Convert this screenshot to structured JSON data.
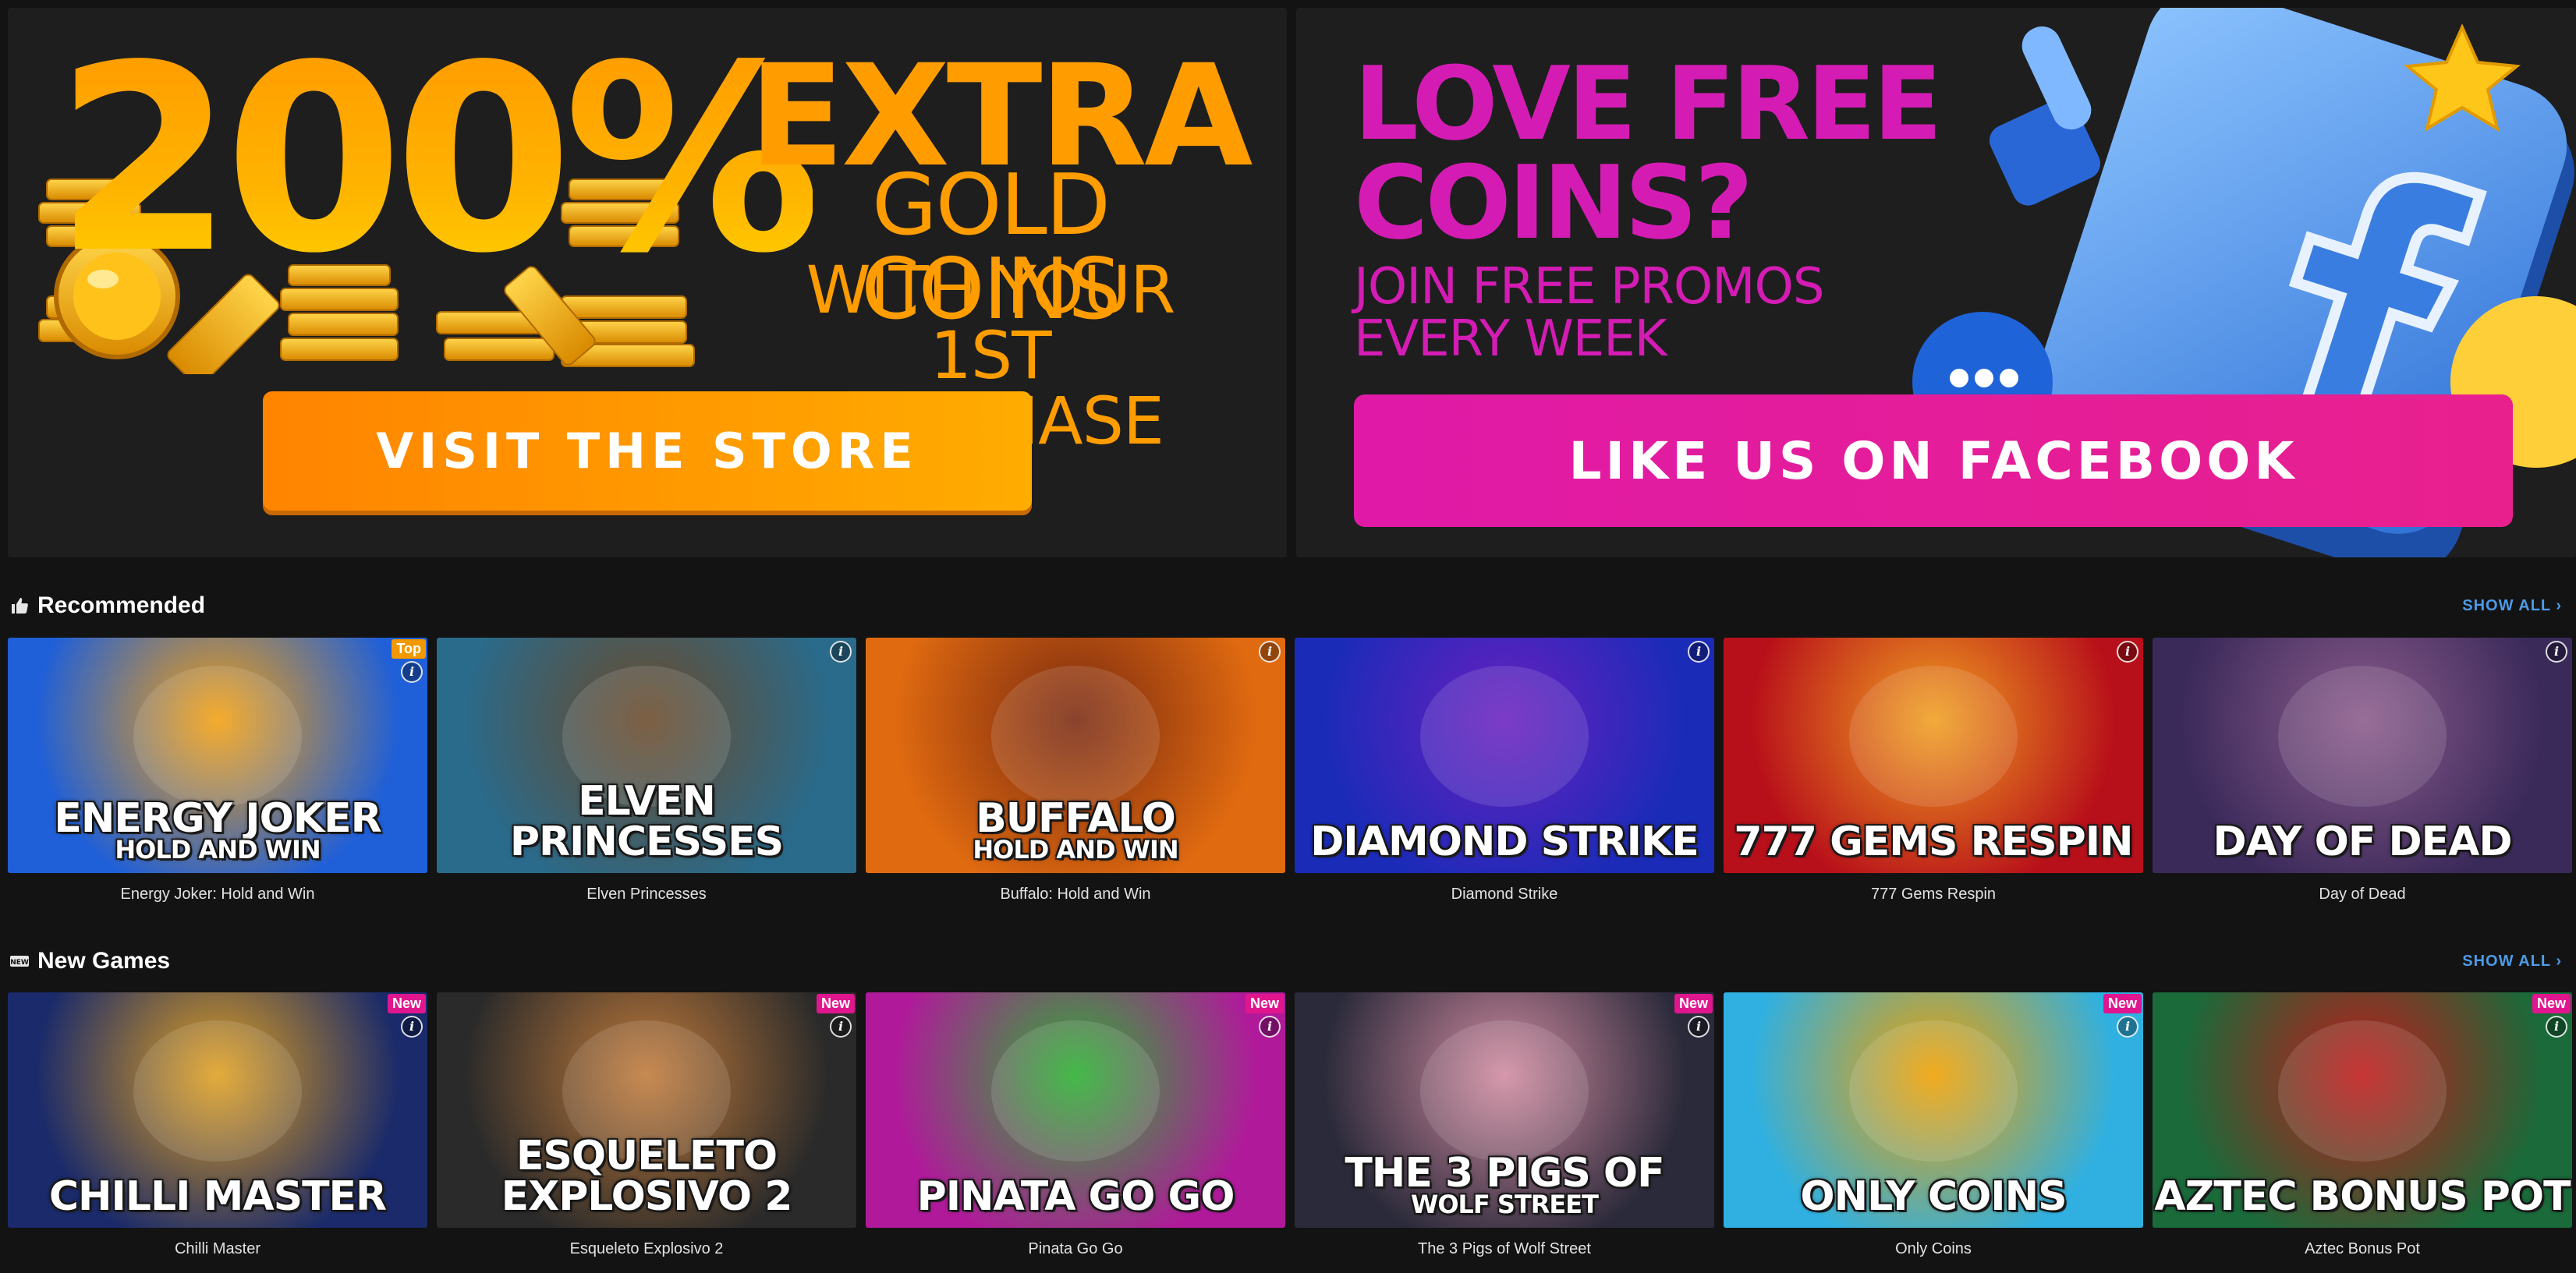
{
  "promo_store": {
    "percent": "200%",
    "extra": "EXTRA",
    "gold_coins": "GOLD COINS",
    "with_your": "WITH YOUR",
    "first_purchase": "1ST PURCHASE",
    "button": "VISIT THE STORE"
  },
  "promo_facebook": {
    "title_line1": "LOVE FREE",
    "title_line2": "COINS?",
    "sub_line1": "JOIN FREE PROMOS",
    "sub_line2": "EVERY WEEK",
    "button": "LIKE US ON FACEBOOK"
  },
  "sections": {
    "recommended": {
      "title": "Recommended",
      "show_all": "SHOW ALL ›",
      "icon": "thumbs-up-icon",
      "games": [
        {
          "art_title": "ENERGY JOKER",
          "art_sub": "HOLD AND WIN",
          "caption": "Energy Joker: Hold and Win",
          "badge": "Top",
          "bg1": "#1f5fd8",
          "bg2": "#f4a010"
        },
        {
          "art_title": "ELVEN PRINCESSES",
          "art_sub": "",
          "caption": "Elven Princesses",
          "badge": "",
          "bg1": "#2a6a8a",
          "bg2": "#6b4a2a"
        },
        {
          "art_title": "BUFFALO",
          "art_sub": "HOLD AND WIN",
          "caption": "Buffalo: Hold and Win",
          "badge": "",
          "bg1": "#e06a10",
          "bg2": "#7a2a10"
        },
        {
          "art_title": "DIAMOND STRIKE",
          "art_sub": "",
          "caption": "Diamond Strike",
          "badge": "",
          "bg1": "#1a2bb8",
          "bg2": "#6a20c0"
        },
        {
          "art_title": "777 GEMS RESPIN",
          "art_sub": "",
          "caption": "777 Gems Respin",
          "badge": "",
          "bg1": "#b8101a",
          "bg2": "#f0a020"
        },
        {
          "art_title": "DAY OF DEAD",
          "art_sub": "",
          "caption": "Day of Dead",
          "badge": "",
          "bg1": "#3a2a5a",
          "bg2": "#8a5a8a"
        }
      ]
    },
    "new_games": {
      "title": "New Games",
      "show_all": "SHOW ALL ›",
      "icon": "new-badge-icon",
      "games": [
        {
          "art_title": "CHILLI MASTER",
          "art_sub": "",
          "caption": "Chilli Master",
          "badge": "New",
          "bg1": "#1a2a6a",
          "bg2": "#e0a020"
        },
        {
          "art_title": "ESQUELETO EXPLOSIVO 2",
          "art_sub": "",
          "caption": "Esqueleto Explosivo 2",
          "badge": "New",
          "bg1": "#2a2a2a",
          "bg2": "#c07a3a"
        },
        {
          "art_title": "PINATA GO GO",
          "art_sub": "",
          "caption": "Pinata Go Go",
          "badge": "New",
          "bg1": "#b01a9a",
          "bg2": "#2ab030"
        },
        {
          "art_title": "THE 3 PIGS OF",
          "art_sub": "WOLF STREET",
          "caption": "The 3 Pigs of Wolf Street",
          "badge": "New",
          "bg1": "#2a2a3a",
          "bg2": "#d08aa0"
        },
        {
          "art_title": "ONLY COINS",
          "art_sub": "",
          "caption": "Only Coins",
          "badge": "New",
          "bg1": "#30b0e0",
          "bg2": "#f0a000"
        },
        {
          "art_title": "AZTEC BONUS POT",
          "art_sub": "",
          "caption": "Aztec Bonus Pot",
          "badge": "New",
          "bg1": "#1a6a3a",
          "bg2": "#c01a1a"
        }
      ]
    }
  }
}
